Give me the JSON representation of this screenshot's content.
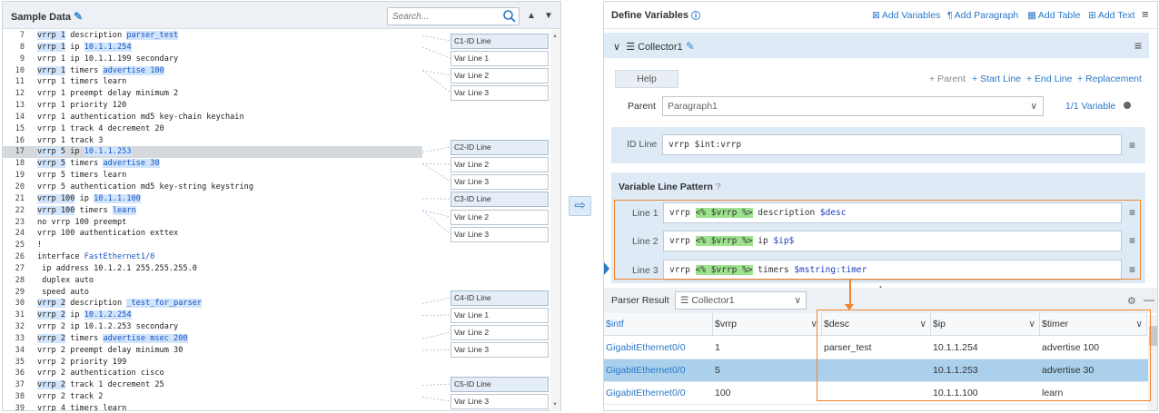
{
  "left": {
    "title": "Sample Data",
    "search_placeholder": "Search...",
    "code_lines": [
      {
        "n": "7",
        "t": "vrrp 1 description parser_test",
        "sel": false
      },
      {
        "n": "8",
        "t": "vrrp 1 ip 10.1.1.254",
        "sel": false
      },
      {
        "n": "9",
        "t": "vrrp 1 ip 10.1.1.199 secondary",
        "sel": false
      },
      {
        "n": "10",
        "t": "vrrp 1 timers advertise 100",
        "sel": false
      },
      {
        "n": "11",
        "t": "vrrp 1 timers learn",
        "sel": false
      },
      {
        "n": "12",
        "t": "vrrp 1 preempt delay minimum 2",
        "sel": false
      },
      {
        "n": "13",
        "t": "vrrp 1 priority 120",
        "sel": false
      },
      {
        "n": "14",
        "t": "vrrp 1 authentication md5 key-chain keychain",
        "sel": false
      },
      {
        "n": "15",
        "t": "vrrp 1 track 4 decrement 20",
        "sel": false
      },
      {
        "n": "16",
        "t": "vrrp 1 track 3",
        "sel": false
      },
      {
        "n": "17",
        "t": "vrrp 5 ip 10.1.1.253",
        "sel": true
      },
      {
        "n": "18",
        "t": "vrrp 5 timers advertise 30",
        "sel": false
      },
      {
        "n": "19",
        "t": "vrrp 5 timers learn",
        "sel": false
      },
      {
        "n": "20",
        "t": "vrrp 5 authentication md5 key-string keystring",
        "sel": false
      },
      {
        "n": "21",
        "t": "vrrp 100 ip 10.1.1.100",
        "sel": false
      },
      {
        "n": "22",
        "t": "vrrp 100 timers learn",
        "sel": false
      },
      {
        "n": "23",
        "t": "no vrrp 100 preempt",
        "sel": false
      },
      {
        "n": "24",
        "t": "vrrp 100 authentication exttex",
        "sel": false
      },
      {
        "n": "25",
        "t": "!",
        "sel": false
      },
      {
        "n": "26",
        "t": "interface FastEthernet1/0",
        "sel": false
      },
      {
        "n": "27",
        "t": " ip address 10.1.2.1 255.255.255.0",
        "sel": false
      },
      {
        "n": "28",
        "t": " duplex auto",
        "sel": false
      },
      {
        "n": "29",
        "t": " speed auto",
        "sel": false
      },
      {
        "n": "30",
        "t": "vrrp 2 description _test_for_parser",
        "sel": false
      },
      {
        "n": "31",
        "t": "vrrp 2 ip 10.1.2.254",
        "sel": false
      },
      {
        "n": "32",
        "t": "vrrp 2 ip 10.1.2.253 secondary",
        "sel": false
      },
      {
        "n": "33",
        "t": "vrrp 2 timers advertise msec 200",
        "sel": false
      },
      {
        "n": "34",
        "t": "vrrp 2 preempt delay minimum 30",
        "sel": false
      },
      {
        "n": "35",
        "t": "vrrp 2 priority 199",
        "sel": false
      },
      {
        "n": "36",
        "t": "vrrp 2 authentication cisco",
        "sel": false
      },
      {
        "n": "37",
        "t": "vrrp 2 track 1 decrement 25",
        "sel": false
      },
      {
        "n": "38",
        "t": "vrrp 2 track 2",
        "sel": false
      },
      {
        "n": "39",
        "t": "vrrp 4 timers learn",
        "sel": false
      }
    ],
    "tags": [
      {
        "label": "C1-ID Line",
        "id": true
      },
      {
        "label": "Var Line 1",
        "id": false
      },
      {
        "label": "Var Line 2",
        "id": false
      },
      {
        "label": "Var Line 3",
        "id": false
      },
      {
        "label": "C2-ID Line",
        "id": true
      },
      {
        "label": "Var Line 2",
        "id": false
      },
      {
        "label": "Var Line 3",
        "id": false
      },
      {
        "label": "C3-ID Line",
        "id": true
      },
      {
        "label": "Var Line 2",
        "id": false
      },
      {
        "label": "Var Line 3",
        "id": false
      },
      {
        "label": "C4-ID Line",
        "id": true
      },
      {
        "label": "Var Line 1",
        "id": false
      },
      {
        "label": "Var Line 2",
        "id": false
      },
      {
        "label": "Var Line 3",
        "id": false
      },
      {
        "label": "C5-ID Line",
        "id": true
      },
      {
        "label": "Var Line 3",
        "id": false
      }
    ]
  },
  "right": {
    "title": "Define Variables",
    "actions": {
      "add_variables": "Add Variables",
      "add_paragraph": "Add Paragraph",
      "add_table": "Add Table",
      "add_text": "Add Text"
    },
    "collector": "Collector1",
    "help": "Help",
    "links": {
      "parent": "+ Parent",
      "start_line": "+ Start Line",
      "end_line": "+ End Line",
      "replacement": "+ Replacement"
    },
    "parent_label": "Parent",
    "parent_value": "Paragraph1",
    "var_count": "1/1 Variable",
    "id_line_label": "ID Line",
    "id_line_value": "vrrp $int:vrrp",
    "vlp_title": "Variable Line Pattern",
    "lines": [
      {
        "label": "Line 1",
        "pre": "vrrp ",
        "mid": "<% $vrrp %>",
        "post": " description ",
        "var": "$desc"
      },
      {
        "label": "Line 2",
        "pre": "vrrp ",
        "mid": "<% $vrrp %>",
        "post": " ip ",
        "var": "$ip$"
      },
      {
        "label": "Line 3",
        "pre": "vrrp ",
        "mid": "<% $vrrp %>",
        "post": " timers ",
        "var": "$mstring:timer"
      }
    ],
    "parser_title": "Parser Result",
    "parser_select": "Collector1",
    "columns": [
      "$intf",
      "$vrrp",
      "$desc",
      "$ip",
      "$timer"
    ],
    "rows": [
      {
        "intf": "GigabitEthernet0/0",
        "vrrp": "1",
        "desc": "parser_test",
        "ip": "10.1.1.254",
        "timer": "advertise 100",
        "sel": false
      },
      {
        "intf": "GigabitEthernet0/0",
        "vrrp": "5",
        "desc": "",
        "ip": "10.1.1.253",
        "timer": "advertise 30",
        "sel": true
      },
      {
        "intf": "GigabitEthernet0/0",
        "vrrp": "100",
        "desc": "",
        "ip": "10.1.1.100",
        "timer": "learn",
        "sel": false
      }
    ]
  },
  "colors": {
    "accent": "#2a78c8",
    "highlight_orange": "#f0842d",
    "pattern_green": "#9de28f",
    "selected_row": "#aad0ec"
  }
}
